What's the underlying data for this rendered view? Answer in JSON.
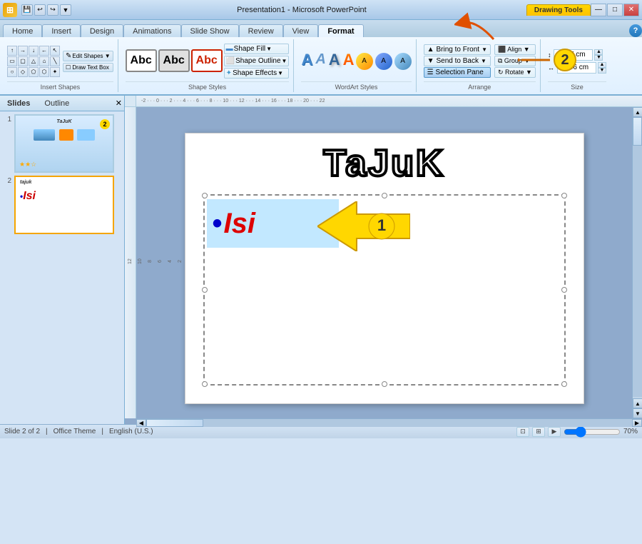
{
  "titleBar": {
    "title": "Presentation1 - Microsoft PowerPoint",
    "drawingToolsLabel": "Drawing Tools",
    "winButtons": [
      "—",
      "□",
      "✕"
    ]
  },
  "ribbonTabs": {
    "tabs": [
      "Home",
      "Insert",
      "Design",
      "Animations",
      "Slide Show",
      "Review",
      "View",
      "Format"
    ],
    "activeTab": "Format",
    "drawingToolsTab": "Drawing Tools"
  },
  "ribbonGroups": {
    "insertShapes": {
      "label": "Insert Shapes"
    },
    "shapeStyles": {
      "label": "Shape Styles"
    },
    "wordartStyles": {
      "label": "WordArt Styles"
    },
    "arrange": {
      "label": "Arrange"
    },
    "size": {
      "label": "Size"
    }
  },
  "shapeStyleDropdowns": [
    {
      "label": "Shape Fill",
      "icon": "▼"
    },
    {
      "label": "Shape Outline",
      "icon": "▼"
    },
    {
      "label": "Shape Effects",
      "icon": "▼"
    }
  ],
  "arrangeButtons": [
    {
      "label": "Bring to Front",
      "icon": "▲",
      "arrow": "▼"
    },
    {
      "label": "Send to Back",
      "icon": "▼",
      "arrow": "▼"
    },
    {
      "label": "Selection Pane",
      "icon": "☰",
      "arrow": ""
    }
  ],
  "sizeFields": [
    {
      "label": "",
      "value": "12.57 cm"
    },
    {
      "label": "",
      "value": "22.86 cm"
    }
  ],
  "slidePanel": {
    "tabs": [
      "Slides",
      "Outline"
    ],
    "activeTab": "Slides",
    "closeBtn": "✕"
  },
  "slides": [
    {
      "number": "1"
    },
    {
      "number": "2"
    }
  ],
  "slide": {
    "tajuk": "TaJuK",
    "isiText": "Isi",
    "bullet": "•"
  },
  "annotations": {
    "num1": "1",
    "num2": "2",
    "arrowColor": "#f5a500"
  },
  "statusBar": {
    "slideInfo": "Slide 2 of 2",
    "theme": "Office Theme",
    "lang": "English (U.S.)"
  }
}
